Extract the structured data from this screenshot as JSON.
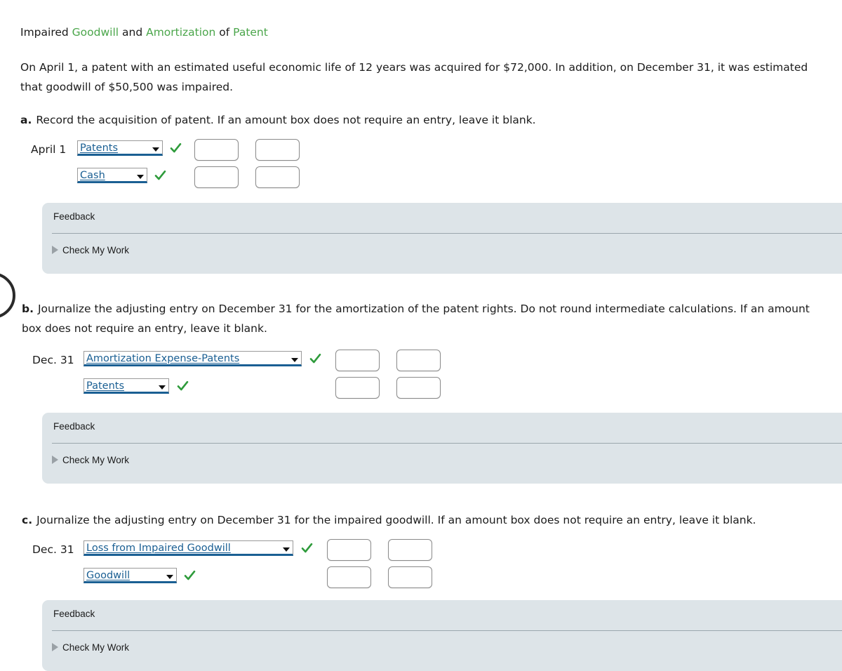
{
  "title": {
    "seg1": "Impaired ",
    "kw1": "Goodwill",
    "seg2": " and ",
    "kw2": "Amortization",
    "seg3": " of ",
    "kw3": "Patent"
  },
  "intro": "On April 1, a patent with an estimated useful economic life of 12 years was acquired for $72,000. In addition, on December 31, it was estimated that goodwill of $50,500 was impaired.",
  "colors": {
    "accent_green": "#4ba64b",
    "check_green": "#2e9b3b",
    "select_blue": "#1a5f93",
    "feedback_bg": "#dde4e8",
    "text": "#1b1b1b"
  },
  "parts": [
    {
      "letter": "a.",
      "prompt": "Record the acquisition of patent. If an amount box does not require an entry, leave it blank.",
      "date": "April 1",
      "rows": [
        {
          "account": "Patents",
          "check": "✔",
          "debit": "",
          "credit": "",
          "debit_placeholder": "",
          "credit_placeholder": ""
        },
        {
          "account": "Cash",
          "check": "✔",
          "debit": "",
          "credit": "",
          "debit_placeholder": "",
          "credit_placeholder": ""
        }
      ],
      "feedback": {
        "title": "Feedback",
        "check_my_work": "Check My Work"
      }
    },
    {
      "letter": "b.",
      "prompt": "Journalize the adjusting entry on December 31 for the amortization of the patent rights. Do not round intermediate calculations. If an amount box does not require an entry, leave it blank.",
      "date": "Dec. 31",
      "rows": [
        {
          "account": "Amortization Expense-Patents",
          "check": "✔",
          "debit": "",
          "credit": "",
          "debit_placeholder": "",
          "credit_placeholder": ""
        },
        {
          "account": "Patents",
          "check": "✔",
          "debit": "",
          "credit": "",
          "debit_placeholder": "",
          "credit_placeholder": ""
        }
      ],
      "feedback": {
        "title": "Feedback",
        "check_my_work": "Check My Work"
      }
    },
    {
      "letter": "c.",
      "prompt": "Journalize the adjusting entry on December 31 for the impaired goodwill. If an amount box does not require an entry, leave it blank.",
      "date": "Dec. 31",
      "rows": [
        {
          "account": "Loss from Impaired Goodwill",
          "check": "✔",
          "debit": "",
          "credit": "",
          "debit_placeholder": "",
          "credit_placeholder": ""
        },
        {
          "account": "Goodwill",
          "check": "✔",
          "debit": "",
          "credit": "",
          "debit_placeholder": "",
          "credit_placeholder": ""
        }
      ],
      "feedback": {
        "title": "Feedback",
        "check_my_work": "Check My Work"
      }
    }
  ]
}
